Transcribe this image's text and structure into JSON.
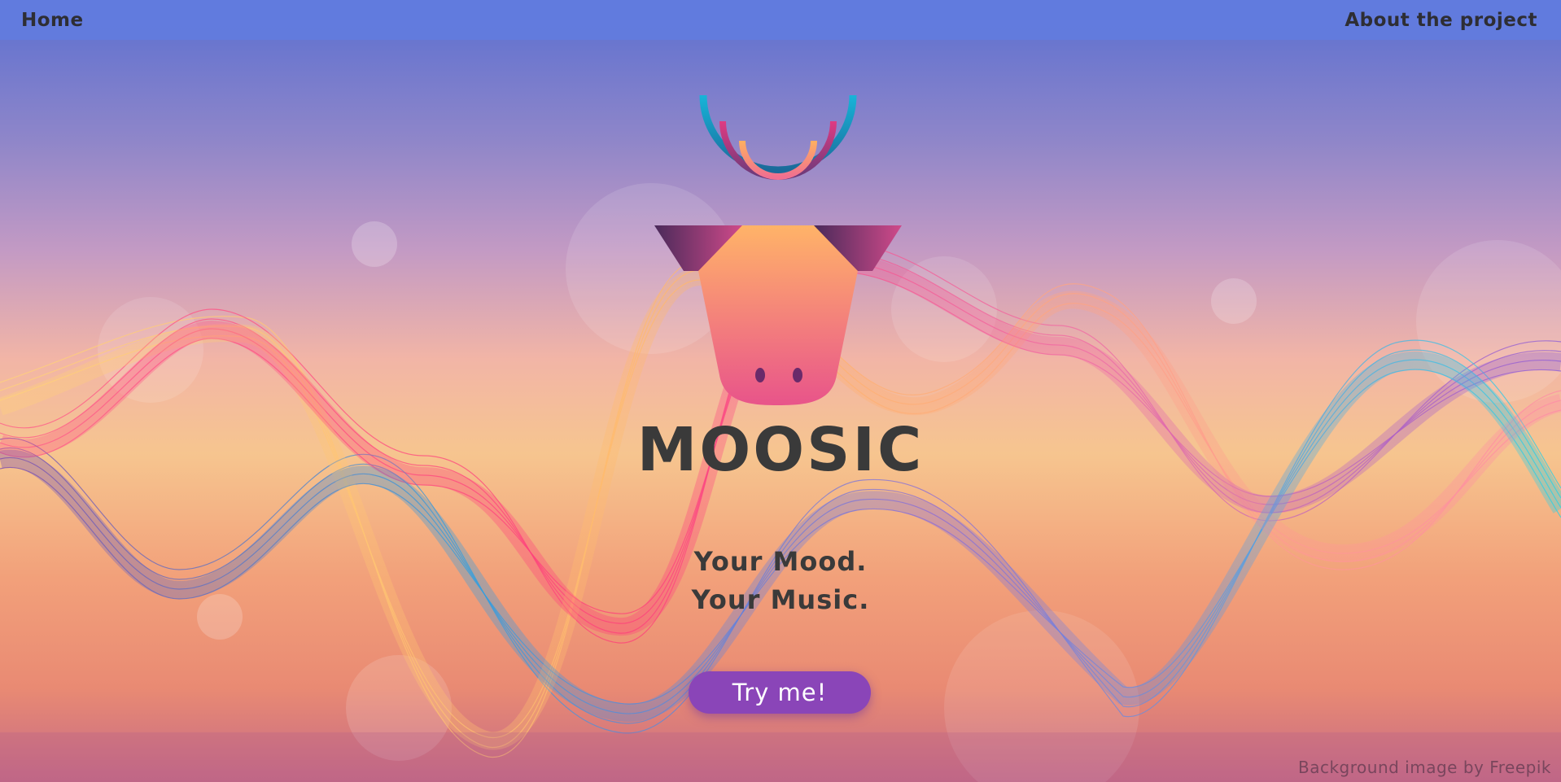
{
  "nav": {
    "home_label": "Home",
    "about_label": "About the project"
  },
  "hero": {
    "title": "MOOSIC",
    "tagline_line1": "Your Mood.",
    "tagline_line2": "Your Music.",
    "cta_label": "Try me!"
  },
  "footer": {
    "credit": "Background image by Freepik"
  },
  "colors": {
    "nav_bar": "#627cde",
    "cta_button": "#8a45b8",
    "text": "#3a3a3a"
  },
  "icons": {
    "logo": "cow-head-with-headphones-logo"
  }
}
